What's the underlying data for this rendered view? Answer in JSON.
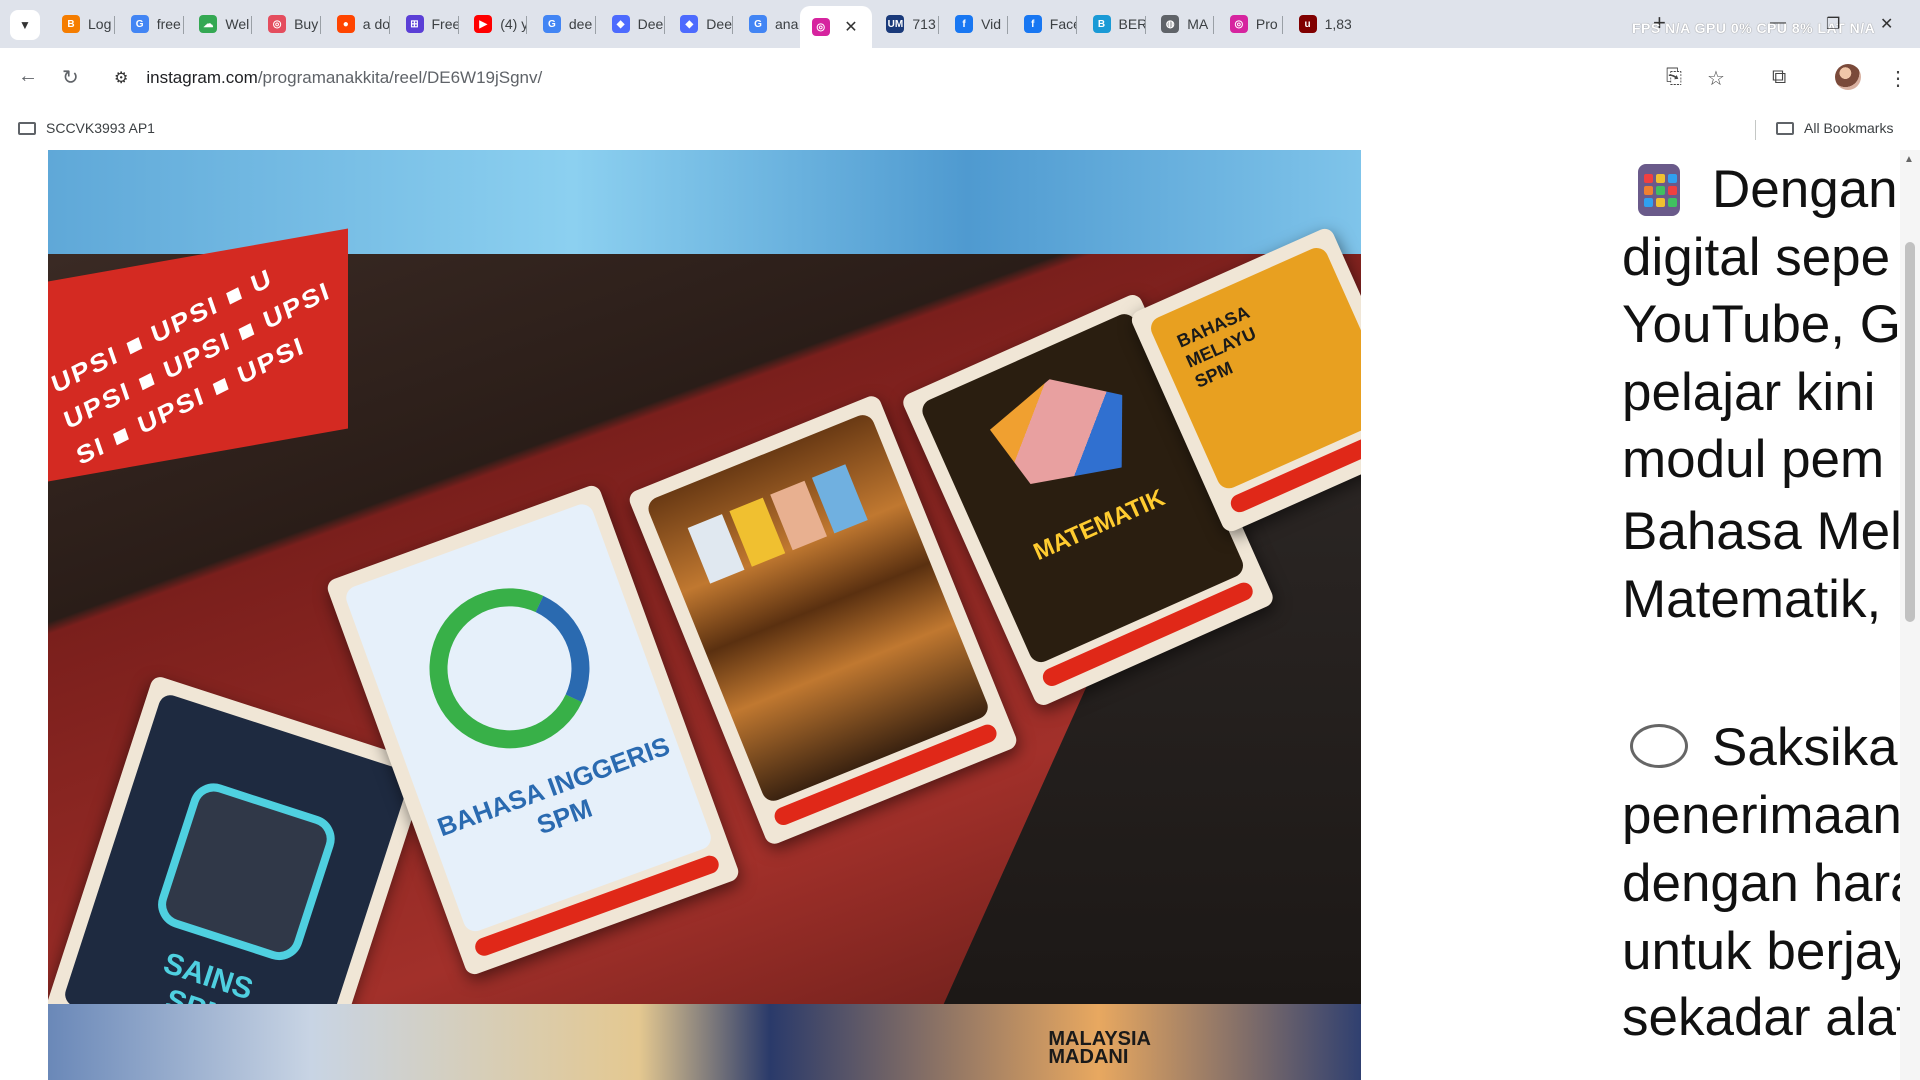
{
  "tabs": [
    {
      "title": "Log",
      "favicon": "blogger-icon",
      "color": "#f57d00",
      "glyph": "B"
    },
    {
      "title": "free",
      "favicon": "google-icon",
      "color": "#4285f4",
      "glyph": "G"
    },
    {
      "title": "Wel",
      "favicon": "cloud-icon",
      "color": "#34a853",
      "glyph": "☁"
    },
    {
      "title": "Buy",
      "favicon": "shop-icon",
      "color": "#e44d5e",
      "glyph": "◎"
    },
    {
      "title": "a do",
      "favicon": "reddit-icon",
      "color": "#ff4500",
      "glyph": "●"
    },
    {
      "title": "Free",
      "favicon": "app-icon",
      "color": "#5b3fd6",
      "glyph": "⊞"
    },
    {
      "title": "(4) y",
      "favicon": "youtube-icon",
      "color": "#ff0000",
      "glyph": "▶"
    },
    {
      "title": "dee",
      "favicon": "google-icon",
      "color": "#4285f4",
      "glyph": "G"
    },
    {
      "title": "Dee",
      "favicon": "deepseek-icon",
      "color": "#4d6bfe",
      "glyph": "◆"
    },
    {
      "title": "Dee",
      "favicon": "deepseek-icon",
      "color": "#4d6bfe",
      "glyph": "◆"
    },
    {
      "title": "ana",
      "favicon": "google-icon",
      "color": "#4285f4",
      "glyph": "G"
    },
    {
      "title": "",
      "favicon": "instagram-icon",
      "color": "#d6249f",
      "glyph": "◎",
      "active": true
    },
    {
      "title": "713",
      "favicon": "um-icon",
      "color": "#1a3a7a",
      "glyph": "UM"
    },
    {
      "title": "Vid",
      "favicon": "facebook-icon",
      "color": "#1877f2",
      "glyph": "f"
    },
    {
      "title": "Face",
      "favicon": "facebook-icon",
      "color": "#1877f2",
      "glyph": "f"
    },
    {
      "title": "BER",
      "favicon": "news-icon",
      "color": "#1a9ad6",
      "glyph": "B"
    },
    {
      "title": "MA",
      "favicon": "globe-icon",
      "color": "#5f6368",
      "glyph": "◍"
    },
    {
      "title": "Pro",
      "favicon": "instagram-icon",
      "color": "#d6249f",
      "glyph": "◎"
    },
    {
      "title": "1,83",
      "favicon": "ublock-icon",
      "color": "#800000",
      "glyph": "u"
    }
  ],
  "overlay_stats": "FPS N/A GPU  0% CPU  8% LAT  N/A",
  "url": {
    "host": "instagram.com",
    "path": "/programanakkita/reel/DE6W19jSgnv/"
  },
  "bookmarks": {
    "folder": "SCCVK3993 AP1",
    "all": "All Bookmarks"
  },
  "video": {
    "upsi": "UPSI ■ UPSI ■ U\nUPSI ■ UPSI ■ UPSI\nSI ■ UPSI ■ UPSI",
    "banner": "MALAYSIA\nMADANI",
    "tablets": [
      {
        "label": "SAINS\nSPM",
        "bg": "#1e2a40",
        "color": "#4fd0e0"
      },
      {
        "label": "BAHASA INGGERIS\nSPM",
        "bg": "#e6f0fa",
        "color": "#2a6ab0"
      },
      {
        "label": "",
        "bg": "#3a2210",
        "color": "#ffffff"
      },
      {
        "label": "MATEMATIK",
        "bg": "#2a1e10",
        "color": "#ffcc30"
      },
      {
        "label": "BAHASA\nMELAYU\nSPM",
        "bg": "#e8a020",
        "color": "#1a1a1a"
      }
    ]
  },
  "caption": {
    "lines": [
      "Dengan",
      "digital sepe",
      "YouTube, Go",
      "pelajar kini",
      "modul pem",
      "Bahasa Mel",
      "Matematik,",
      "Saksikan",
      "penerimaan",
      "dengan hara",
      "untuk berjay",
      "sekadar alat"
    ]
  }
}
